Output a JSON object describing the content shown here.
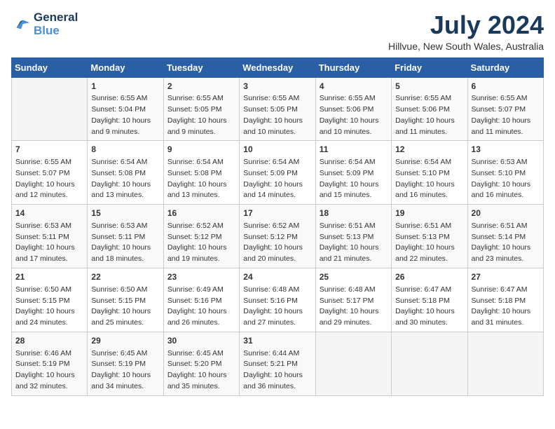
{
  "header": {
    "logo_line1": "General",
    "logo_line2": "Blue",
    "title": "July 2024",
    "subtitle": "Hillvue, New South Wales, Australia"
  },
  "weekdays": [
    "Sunday",
    "Monday",
    "Tuesday",
    "Wednesday",
    "Thursday",
    "Friday",
    "Saturday"
  ],
  "weeks": [
    [
      {
        "day": "",
        "sunrise": "",
        "sunset": "",
        "daylight": ""
      },
      {
        "day": "1",
        "sunrise": "Sunrise: 6:55 AM",
        "sunset": "Sunset: 5:04 PM",
        "daylight": "Daylight: 10 hours and 9 minutes."
      },
      {
        "day": "2",
        "sunrise": "Sunrise: 6:55 AM",
        "sunset": "Sunset: 5:05 PM",
        "daylight": "Daylight: 10 hours and 9 minutes."
      },
      {
        "day": "3",
        "sunrise": "Sunrise: 6:55 AM",
        "sunset": "Sunset: 5:05 PM",
        "daylight": "Daylight: 10 hours and 10 minutes."
      },
      {
        "day": "4",
        "sunrise": "Sunrise: 6:55 AM",
        "sunset": "Sunset: 5:06 PM",
        "daylight": "Daylight: 10 hours and 10 minutes."
      },
      {
        "day": "5",
        "sunrise": "Sunrise: 6:55 AM",
        "sunset": "Sunset: 5:06 PM",
        "daylight": "Daylight: 10 hours and 11 minutes."
      },
      {
        "day": "6",
        "sunrise": "Sunrise: 6:55 AM",
        "sunset": "Sunset: 5:07 PM",
        "daylight": "Daylight: 10 hours and 11 minutes."
      }
    ],
    [
      {
        "day": "7",
        "sunrise": "Sunrise: 6:55 AM",
        "sunset": "Sunset: 5:07 PM",
        "daylight": "Daylight: 10 hours and 12 minutes."
      },
      {
        "day": "8",
        "sunrise": "Sunrise: 6:54 AM",
        "sunset": "Sunset: 5:08 PM",
        "daylight": "Daylight: 10 hours and 13 minutes."
      },
      {
        "day": "9",
        "sunrise": "Sunrise: 6:54 AM",
        "sunset": "Sunset: 5:08 PM",
        "daylight": "Daylight: 10 hours and 13 minutes."
      },
      {
        "day": "10",
        "sunrise": "Sunrise: 6:54 AM",
        "sunset": "Sunset: 5:09 PM",
        "daylight": "Daylight: 10 hours and 14 minutes."
      },
      {
        "day": "11",
        "sunrise": "Sunrise: 6:54 AM",
        "sunset": "Sunset: 5:09 PM",
        "daylight": "Daylight: 10 hours and 15 minutes."
      },
      {
        "day": "12",
        "sunrise": "Sunrise: 6:54 AM",
        "sunset": "Sunset: 5:10 PM",
        "daylight": "Daylight: 10 hours and 16 minutes."
      },
      {
        "day": "13",
        "sunrise": "Sunrise: 6:53 AM",
        "sunset": "Sunset: 5:10 PM",
        "daylight": "Daylight: 10 hours and 16 minutes."
      }
    ],
    [
      {
        "day": "14",
        "sunrise": "Sunrise: 6:53 AM",
        "sunset": "Sunset: 5:11 PM",
        "daylight": "Daylight: 10 hours and 17 minutes."
      },
      {
        "day": "15",
        "sunrise": "Sunrise: 6:53 AM",
        "sunset": "Sunset: 5:11 PM",
        "daylight": "Daylight: 10 hours and 18 minutes."
      },
      {
        "day": "16",
        "sunrise": "Sunrise: 6:52 AM",
        "sunset": "Sunset: 5:12 PM",
        "daylight": "Daylight: 10 hours and 19 minutes."
      },
      {
        "day": "17",
        "sunrise": "Sunrise: 6:52 AM",
        "sunset": "Sunset: 5:12 PM",
        "daylight": "Daylight: 10 hours and 20 minutes."
      },
      {
        "day": "18",
        "sunrise": "Sunrise: 6:51 AM",
        "sunset": "Sunset: 5:13 PM",
        "daylight": "Daylight: 10 hours and 21 minutes."
      },
      {
        "day": "19",
        "sunrise": "Sunrise: 6:51 AM",
        "sunset": "Sunset: 5:13 PM",
        "daylight": "Daylight: 10 hours and 22 minutes."
      },
      {
        "day": "20",
        "sunrise": "Sunrise: 6:51 AM",
        "sunset": "Sunset: 5:14 PM",
        "daylight": "Daylight: 10 hours and 23 minutes."
      }
    ],
    [
      {
        "day": "21",
        "sunrise": "Sunrise: 6:50 AM",
        "sunset": "Sunset: 5:15 PM",
        "daylight": "Daylight: 10 hours and 24 minutes."
      },
      {
        "day": "22",
        "sunrise": "Sunrise: 6:50 AM",
        "sunset": "Sunset: 5:15 PM",
        "daylight": "Daylight: 10 hours and 25 minutes."
      },
      {
        "day": "23",
        "sunrise": "Sunrise: 6:49 AM",
        "sunset": "Sunset: 5:16 PM",
        "daylight": "Daylight: 10 hours and 26 minutes."
      },
      {
        "day": "24",
        "sunrise": "Sunrise: 6:48 AM",
        "sunset": "Sunset: 5:16 PM",
        "daylight": "Daylight: 10 hours and 27 minutes."
      },
      {
        "day": "25",
        "sunrise": "Sunrise: 6:48 AM",
        "sunset": "Sunset: 5:17 PM",
        "daylight": "Daylight: 10 hours and 29 minutes."
      },
      {
        "day": "26",
        "sunrise": "Sunrise: 6:47 AM",
        "sunset": "Sunset: 5:18 PM",
        "daylight": "Daylight: 10 hours and 30 minutes."
      },
      {
        "day": "27",
        "sunrise": "Sunrise: 6:47 AM",
        "sunset": "Sunset: 5:18 PM",
        "daylight": "Daylight: 10 hours and 31 minutes."
      }
    ],
    [
      {
        "day": "28",
        "sunrise": "Sunrise: 6:46 AM",
        "sunset": "Sunset: 5:19 PM",
        "daylight": "Daylight: 10 hours and 32 minutes."
      },
      {
        "day": "29",
        "sunrise": "Sunrise: 6:45 AM",
        "sunset": "Sunset: 5:19 PM",
        "daylight": "Daylight: 10 hours and 34 minutes."
      },
      {
        "day": "30",
        "sunrise": "Sunrise: 6:45 AM",
        "sunset": "Sunset: 5:20 PM",
        "daylight": "Daylight: 10 hours and 35 minutes."
      },
      {
        "day": "31",
        "sunrise": "Sunrise: 6:44 AM",
        "sunset": "Sunset: 5:21 PM",
        "daylight": "Daylight: 10 hours and 36 minutes."
      },
      {
        "day": "",
        "sunrise": "",
        "sunset": "",
        "daylight": ""
      },
      {
        "day": "",
        "sunrise": "",
        "sunset": "",
        "daylight": ""
      },
      {
        "day": "",
        "sunrise": "",
        "sunset": "",
        "daylight": ""
      }
    ]
  ]
}
